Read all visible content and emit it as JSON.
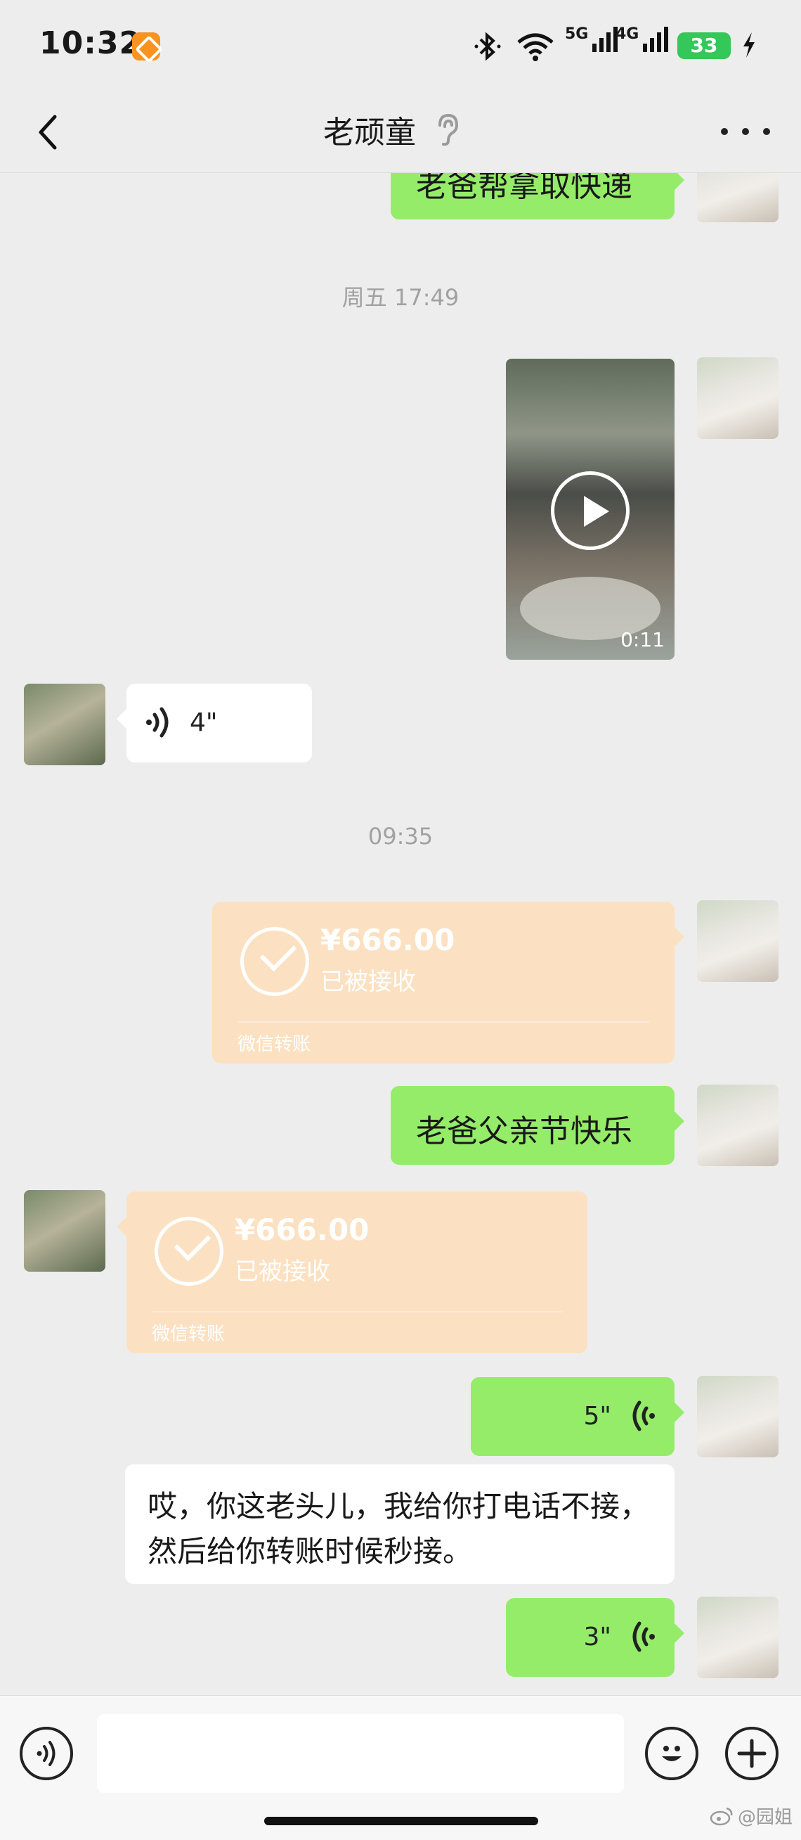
{
  "status_bar": {
    "time": "10:32",
    "signal1_label": "5G",
    "signal2_label": "4G",
    "battery": "33"
  },
  "nav": {
    "title": "老顽童",
    "back_icon": "chevron-left-icon",
    "ear_icon": "ear-icon",
    "more_icon": "more-icon"
  },
  "messages": {
    "m1_text": "老爸帮拿取快递",
    "ts1": "周五 17:49",
    "video_duration": "0:11",
    "voice1_duration": "4\"",
    "ts2": "09:35",
    "transfer1": {
      "amount": "¥666.00",
      "status": "已被接收",
      "label": "微信转账"
    },
    "m2_text": "老爸父亲节快乐",
    "transfer2": {
      "amount": "¥666.00",
      "status": "已被接收",
      "label": "微信转账"
    },
    "voice2_duration": "5\"",
    "m3_text": "哎，你这老头儿，我给你打电话不接，然后给你转账时候秒接。",
    "voice3_duration": "3\""
  },
  "input_bar": {
    "placeholder": "",
    "voice_icon": "voice-icon",
    "emoji_icon": "emoji-icon",
    "plus_icon": "plus-icon"
  },
  "watermark": "@园姐",
  "colors": {
    "background": "#ededed",
    "my_bubble": "#95ec69",
    "transfer": "#fbe1c2",
    "accent_orange": "#f7931e"
  }
}
